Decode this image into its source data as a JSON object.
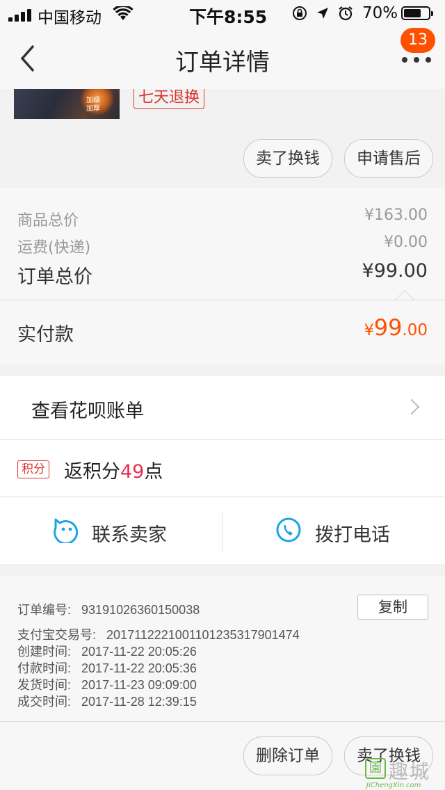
{
  "status_bar": {
    "carrier": "中国移动",
    "time": "下午8:55",
    "battery_pct": "70%",
    "battery_level": 0.7
  },
  "nav": {
    "title": "订单详情",
    "badge": "13"
  },
  "product": {
    "thumb_tag_line1": "加级",
    "thumb_tag_line2": "加厚",
    "service_tag": "七天退换",
    "btn_sell": "卖了换钱",
    "btn_aftersale": "申请售后"
  },
  "prices": {
    "goods_label": "商品总价",
    "goods_value": "¥163.00",
    "shipping_label": "运费(快递)",
    "shipping_value": "¥0.00",
    "order_label": "订单总价",
    "order_value": "¥99.00",
    "paid_label": "实付款",
    "paid_currency": "¥",
    "paid_int": "99",
    "paid_dec": ".00"
  },
  "huabei": {
    "label": "查看花呗账单"
  },
  "points": {
    "tag": "积分",
    "prefix": "返积分",
    "number": "49",
    "suffix": "点"
  },
  "contact": {
    "seller": "联系卖家",
    "phone": "拨打电话"
  },
  "order_info": {
    "order_no_label": "订单编号:",
    "order_no": "93191026360150038",
    "copy_btn": "复制",
    "alipay_label": "支付宝交易号:",
    "alipay_no": "2017112221001101235317901474",
    "created_label": "创建时间:",
    "created": "2017-11-22 20:05:26",
    "paid_label": "付款时间:",
    "paid": "2017-11-22 20:05:36",
    "shipped_label": "发货时间:",
    "shipped": "2017-11-23 09:09:00",
    "done_label": "成交时间:",
    "done": "2017-11-28 12:39:15"
  },
  "bottom_actions": {
    "delete": "删除订单",
    "sell": "卖了换钱"
  },
  "watermark": {
    "icon_char": "園",
    "text": "趣城",
    "site": "JiChengXin.com"
  },
  "colors": {
    "accent_orange": "#ff5000",
    "tag_red": "#d9332f",
    "points_pink": "#e8304d",
    "contact_blue": "#1aa3e6"
  }
}
